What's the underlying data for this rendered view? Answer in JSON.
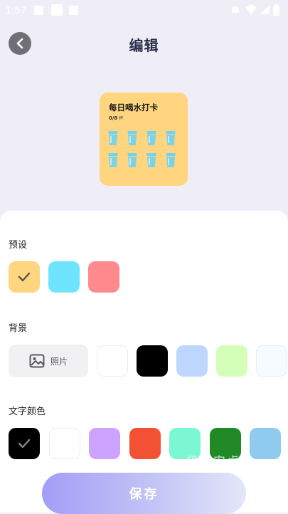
{
  "status_bar": {
    "time": "1:57"
  },
  "header": {
    "title": "编辑"
  },
  "widget": {
    "title": "每日喝水打卡",
    "count": "0/8",
    "unit": "杯",
    "cups": 8,
    "background": "#ffd57f",
    "cup_color": "#6fd3f2"
  },
  "presets": {
    "label": "预设",
    "colors": [
      "#ffd57f",
      "#6fe4ff",
      "#ff8a8e"
    ],
    "selected_index": 0
  },
  "background": {
    "label": "背景",
    "photo_label": "照片",
    "colors": [
      "#ffffff",
      "#000000",
      "#bfd6ff",
      "#d4ffb8",
      "#f6fbff"
    ]
  },
  "text_color": {
    "label": "文字颜色",
    "colors": [
      "#000000",
      "#ffffff",
      "#cca3ff",
      "#f25233",
      "#7bf7d3",
      "#218a26",
      "#8ecbee"
    ],
    "selected_index": 0
  },
  "save_button": {
    "label": "保存"
  },
  "watermark": {
    "text": "极光安卓网"
  }
}
